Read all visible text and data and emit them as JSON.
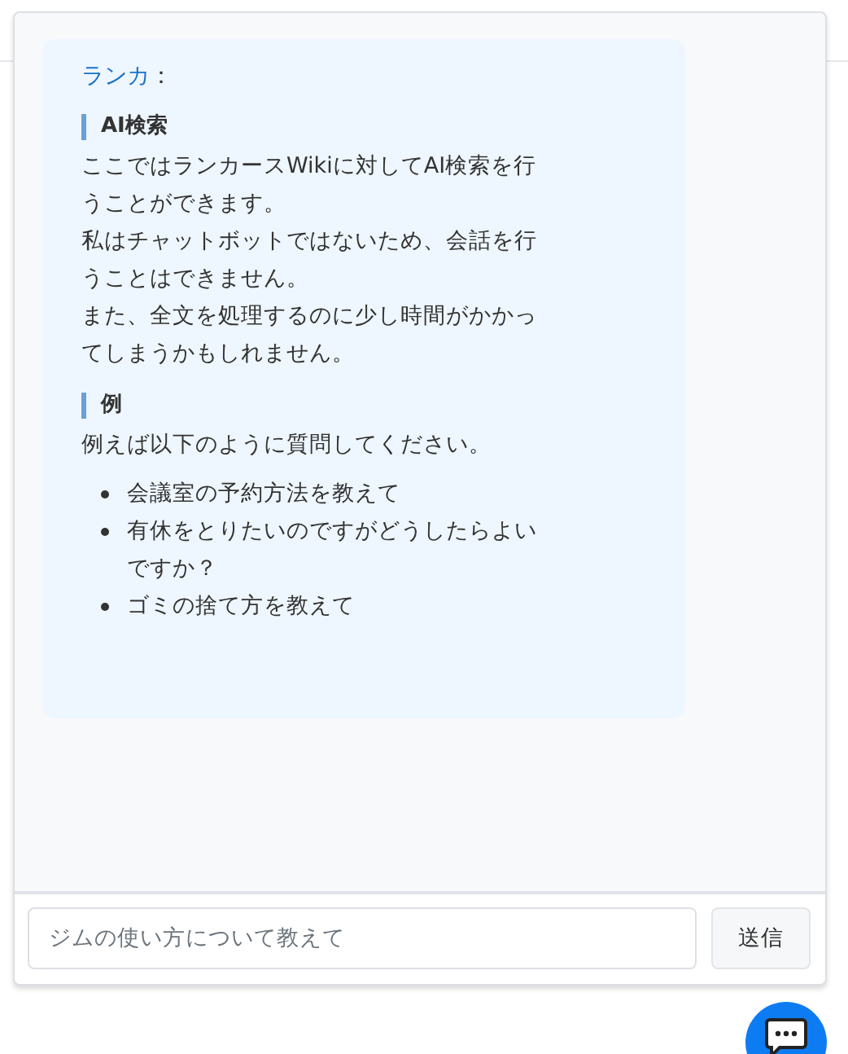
{
  "message": {
    "sender": "ランカ",
    "separator": "：",
    "sections": [
      {
        "heading": "AI検索",
        "paragraphs": [
          "ここではランカースWikiに対してAI検索を行うことができます。",
          "私はチャットボットではないため、会話を行うことはできません。",
          "また、全文を処理するのに少し時間がかかってしまうかもしれません。"
        ]
      },
      {
        "heading": "例",
        "paragraphs": [
          "例えば以下のように質問してください。"
        ],
        "bullets": [
          "会議室の予約方法を教えて",
          "有休をとりたいのですがどうしたらよいですか？",
          "ゴミの捨て方を教えて"
        ]
      }
    ]
  },
  "input": {
    "placeholder": "ジムの使い方について教えて"
  },
  "send_button": "送信"
}
